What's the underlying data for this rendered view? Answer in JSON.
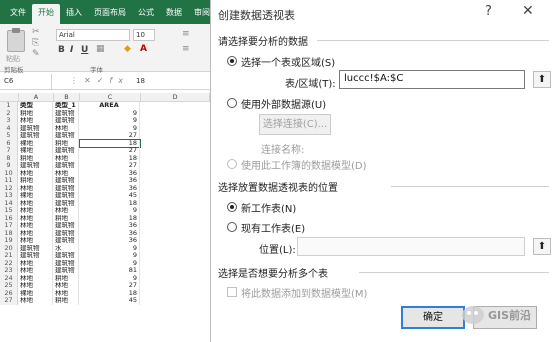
{
  "excel": {
    "tabs": [
      "文件",
      "开始",
      "插入",
      "页面布局",
      "公式",
      "数据",
      "审阅"
    ],
    "active_tab": "开始",
    "paste_label": "粘贴",
    "clipboard_label": "剪贴板",
    "font_group_label": "字体",
    "font_name": "Arial",
    "font_size": "10",
    "bold": "B",
    "italic": "I",
    "underline": "U",
    "name_box": "C6",
    "formula_value": "18",
    "column_headers": [
      "A",
      "B",
      "C",
      "D"
    ],
    "header_row": {
      "num": "1",
      "a": "类型",
      "b": "类型_1",
      "c": "AREA"
    },
    "rows": [
      {
        "num": "2",
        "a": "耕地",
        "b": "建筑物",
        "c": "9"
      },
      {
        "num": "3",
        "a": "林地",
        "b": "建筑物",
        "c": "9"
      },
      {
        "num": "4",
        "a": "建筑物",
        "b": "林地",
        "c": "9"
      },
      {
        "num": "5",
        "a": "建筑物",
        "b": "建筑物",
        "c": "27"
      },
      {
        "num": "6",
        "a": "裸地",
        "b": "耕地",
        "c": "18"
      },
      {
        "num": "7",
        "a": "裸地",
        "b": "建筑物",
        "c": "27"
      },
      {
        "num": "8",
        "a": "耕地",
        "b": "林地",
        "c": "18"
      },
      {
        "num": "9",
        "a": "建筑物",
        "b": "建筑物",
        "c": "27"
      },
      {
        "num": "10",
        "a": "林地",
        "b": "林地",
        "c": "36"
      },
      {
        "num": "11",
        "a": "耕地",
        "b": "建筑物",
        "c": "36"
      },
      {
        "num": "12",
        "a": "林地",
        "b": "建筑物",
        "c": "36"
      },
      {
        "num": "13",
        "a": "裸地",
        "b": "建筑物",
        "c": "45"
      },
      {
        "num": "14",
        "a": "林地",
        "b": "建筑物",
        "c": "18"
      },
      {
        "num": "15",
        "a": "林地",
        "b": "林地",
        "c": "9"
      },
      {
        "num": "16",
        "a": "林地",
        "b": "耕地",
        "c": "18"
      },
      {
        "num": "17",
        "a": "林地",
        "b": "建筑物",
        "c": "36"
      },
      {
        "num": "18",
        "a": "林地",
        "b": "建筑物",
        "c": "36"
      },
      {
        "num": "19",
        "a": "林地",
        "b": "建筑物",
        "c": "36"
      },
      {
        "num": "20",
        "a": "建筑物",
        "b": "水",
        "c": "9"
      },
      {
        "num": "21",
        "a": "建筑物",
        "b": "建筑物",
        "c": "9"
      },
      {
        "num": "22",
        "a": "林地",
        "b": "建筑物",
        "c": "9"
      },
      {
        "num": "23",
        "a": "林地",
        "b": "建筑物",
        "c": "81"
      },
      {
        "num": "24",
        "a": "林地",
        "b": "耕地",
        "c": "9"
      },
      {
        "num": "25",
        "a": "林地",
        "b": "林地",
        "c": "27"
      },
      {
        "num": "26",
        "a": "裸地",
        "b": "林地",
        "c": "18"
      },
      {
        "num": "27",
        "a": "林地",
        "b": "耕地",
        "c": "45"
      }
    ]
  },
  "dialog": {
    "title": "创建数据透视表",
    "help_icon": "?",
    "close_icon": "✕",
    "section_choose_data": "请选择要分析的数据",
    "option_select_range": "选择一个表或区域(S)",
    "table_range_label": "表/区域(T):",
    "table_range_value": "luccc!$A:$C",
    "option_external": "使用外部数据源(U)",
    "choose_connection": "选择连接(C)...",
    "connection_name_label": "连接名称:",
    "option_data_model": "使用此工作簿的数据模型(D)",
    "section_location": "选择放置数据透视表的位置",
    "option_new_sheet": "新工作表(N)",
    "option_existing_sheet": "现有工作表(E)",
    "location_label": "位置(L):",
    "location_value": "",
    "section_multi": "选择是否想要分析多个表",
    "add_to_model": "将此数据添加到数据模型(M)",
    "ok": "确定",
    "collapse_icon": "⬆"
  },
  "watermark": {
    "text": "GIS前沿"
  }
}
